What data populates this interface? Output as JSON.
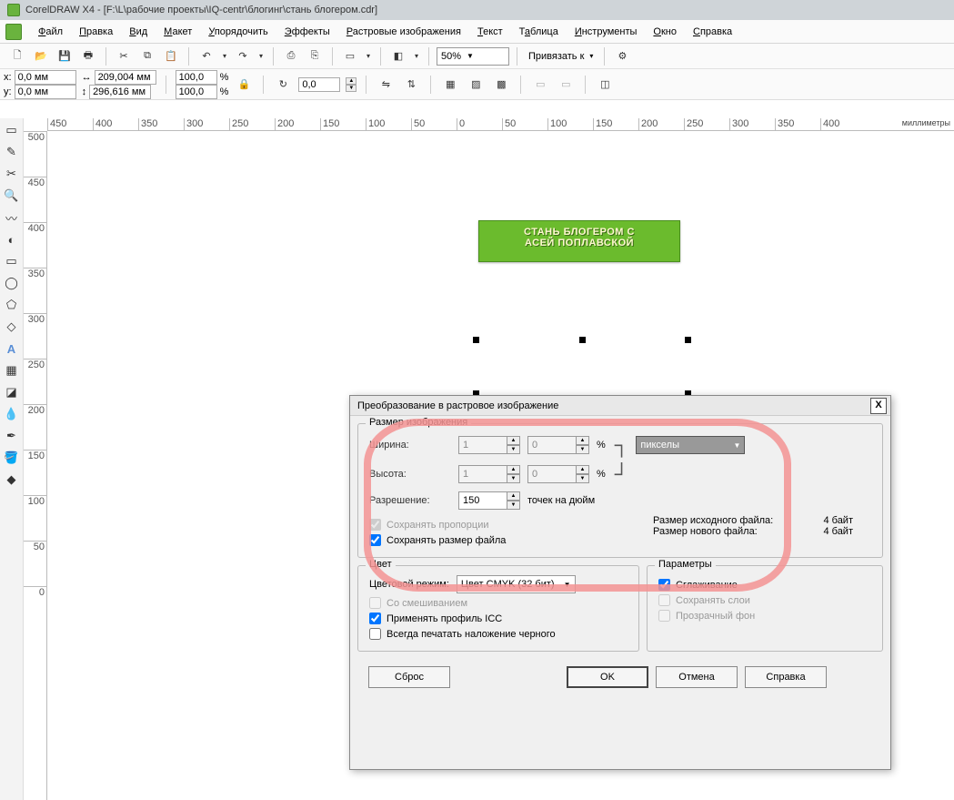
{
  "title": "CorelDRAW X4 - [F:\\L\\рабочие проекты\\IQ-centr\\блогинг\\стань блогером.cdr]",
  "menu": {
    "file": "Файл",
    "edit": "Правка",
    "view": "Вид",
    "layout": "Макет",
    "arrange": "Упорядочить",
    "effects": "Эффекты",
    "bitmaps": "Растровые изображения",
    "text": "Текст",
    "table": "Таблица",
    "tools": "Инструменты",
    "window": "Окно",
    "help": "Справка"
  },
  "toolbar": {
    "zoom": "50%",
    "snap_label": "Привязать к",
    "snap_arrow": "▾"
  },
  "prop": {
    "x_label": "x:",
    "x_val": "0,0 мм",
    "y_label": "y:",
    "y_val": "0,0 мм",
    "w_icon": "↔",
    "w_val": "209,004 мм",
    "h_icon": "↕",
    "h_val": "296,616 мм",
    "scale_x": "100,0",
    "scale_y": "100,0",
    "pct": "%",
    "lock": "🔒",
    "rot_icon": "↻",
    "rot_val": "0,0"
  },
  "ruler_unit": "миллиметры",
  "hruler": [
    "450",
    "400",
    "350",
    "300",
    "250",
    "200",
    "150",
    "100",
    "50",
    "0",
    "50",
    "100",
    "150",
    "200",
    "250",
    "300",
    "350",
    "400"
  ],
  "vruler": [
    "500",
    "450",
    "400",
    "350",
    "300",
    "250",
    "200",
    "150",
    "100",
    "50",
    "0"
  ],
  "banner": {
    "line1": "СТАНЬ БЛОГЕРОМ С",
    "line2": "АСЕЙ ПОПЛАВСКОЙ"
  },
  "dialog": {
    "title": "Преобразование в растровое изображение",
    "close": "X",
    "grp_size": "Размер изображения",
    "width_label": "Ширина:",
    "width_val": "1",
    "width_pct": "0",
    "height_label": "Высота:",
    "height_val": "1",
    "height_pct": "0",
    "pct": "%",
    "res_label": "Разрешение:",
    "res_val": "150",
    "res_unit": "точек на дюйм",
    "unit_sel": "пикселы",
    "keep_ratio": "Сохранять пропорции",
    "keep_filesize": "Сохранять размер файла",
    "orig_size_label": "Размер исходного файла:",
    "orig_size_val": "4 байт",
    "new_size_label": "Размер нового файла:",
    "new_size_val": "4 байт",
    "grp_color": "Цвет",
    "color_mode_label": "Цветовой режим:",
    "color_mode_val": "Цвет CMYK (32 бит)",
    "dither": "Со смешиванием",
    "icc": "Применять профиль ICC",
    "overprint": "Всегда печатать наложение черного",
    "grp_params": "Параметры",
    "antialias": "Сглаживание",
    "keep_layers": "Сохранять слои",
    "transparent": "Прозрачный фон",
    "btn_reset": "Сброс",
    "btn_ok": "OK",
    "btn_cancel": "Отмена",
    "btn_help": "Справка"
  }
}
